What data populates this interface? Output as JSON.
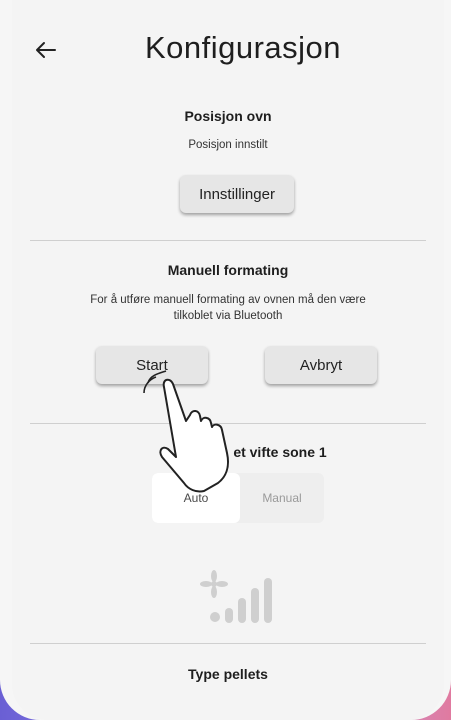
{
  "header": {
    "title": "Konfigurasjon"
  },
  "position": {
    "title": "Posisjon ovn",
    "status": "Posisjon innstilt",
    "settings_button": "Innstillinger"
  },
  "manual_formatting": {
    "title": "Manuell formating",
    "description_line1": "For å utføre manuell formating av ovnen må den være",
    "description_line2": "tilkoblet via Bluetooth",
    "start_button": "Start",
    "cancel_button": "Avbryt"
  },
  "fan_zone": {
    "title": "Hastighet vifte sone 1",
    "title_visible": "et vifte sone 1",
    "options": [
      "Auto",
      "Manual"
    ],
    "selected": "Auto",
    "level_icon": "fan-level-icon",
    "bar_color": "#cfcfcf"
  },
  "pellets": {
    "title": "Type pellets"
  },
  "colors": {
    "background": "#f4f4f4",
    "button": "#e6e6e6",
    "divider": "#cfcfcf"
  }
}
